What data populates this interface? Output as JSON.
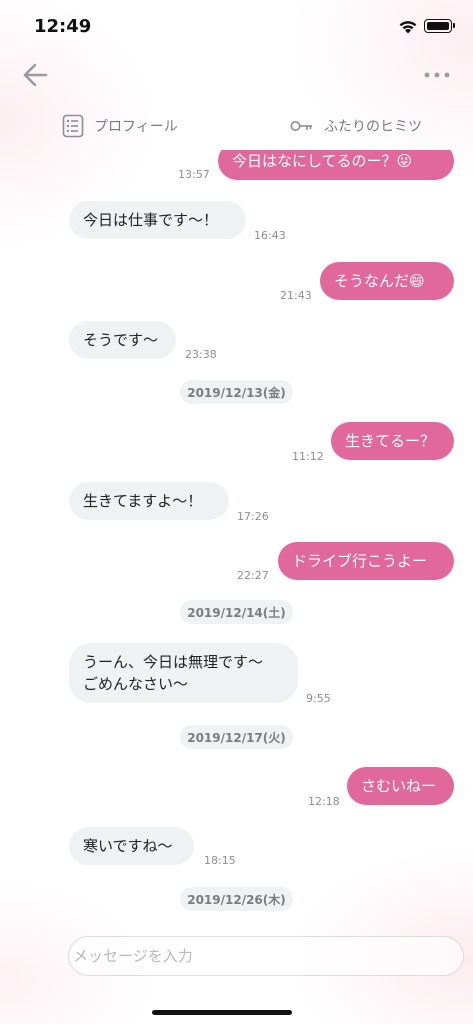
{
  "status_bar": {
    "time": "12:49"
  },
  "tabs": [
    {
      "label": "プロフィール",
      "icon": "list-icon"
    },
    {
      "label": "ふたりのヒミツ",
      "icon": "key-icon"
    }
  ],
  "colors": {
    "accent": "#e0689a",
    "incoming_bubble": "#f0f1f3",
    "timestamp": "#8e8e93"
  },
  "messages": [
    {
      "from": "me",
      "text": "今日はなにしてるのー？😜",
      "time": "13:57"
    },
    {
      "from": "them",
      "text": "今日は仕事です〜！",
      "time": "16:43"
    },
    {
      "from": "me",
      "text": "そうなんだ😄",
      "time": "21:43"
    },
    {
      "from": "them",
      "text": "そうです〜",
      "time": "23:38"
    },
    {
      "date": "2019/12/13(金)"
    },
    {
      "from": "me",
      "text": "生きてるー？",
      "time": "11:12"
    },
    {
      "from": "them",
      "text": "生きてますよ〜！",
      "time": "17:26"
    },
    {
      "from": "me",
      "text": "ドライブ行こうよー",
      "time": "22:27"
    },
    {
      "date": "2019/12/14(土)"
    },
    {
      "from": "them",
      "text": "うーん、今日は無理です〜\nごめんなさい〜",
      "time": "9:55"
    },
    {
      "date": "2019/12/17(火)"
    },
    {
      "from": "me",
      "text": "さむいねー",
      "time": "12:18"
    },
    {
      "from": "them",
      "text": "寒いですね〜",
      "time": "18:15"
    },
    {
      "date": "2019/12/26(木)"
    }
  ],
  "composer": {
    "placeholder": "メッセージを入力"
  }
}
